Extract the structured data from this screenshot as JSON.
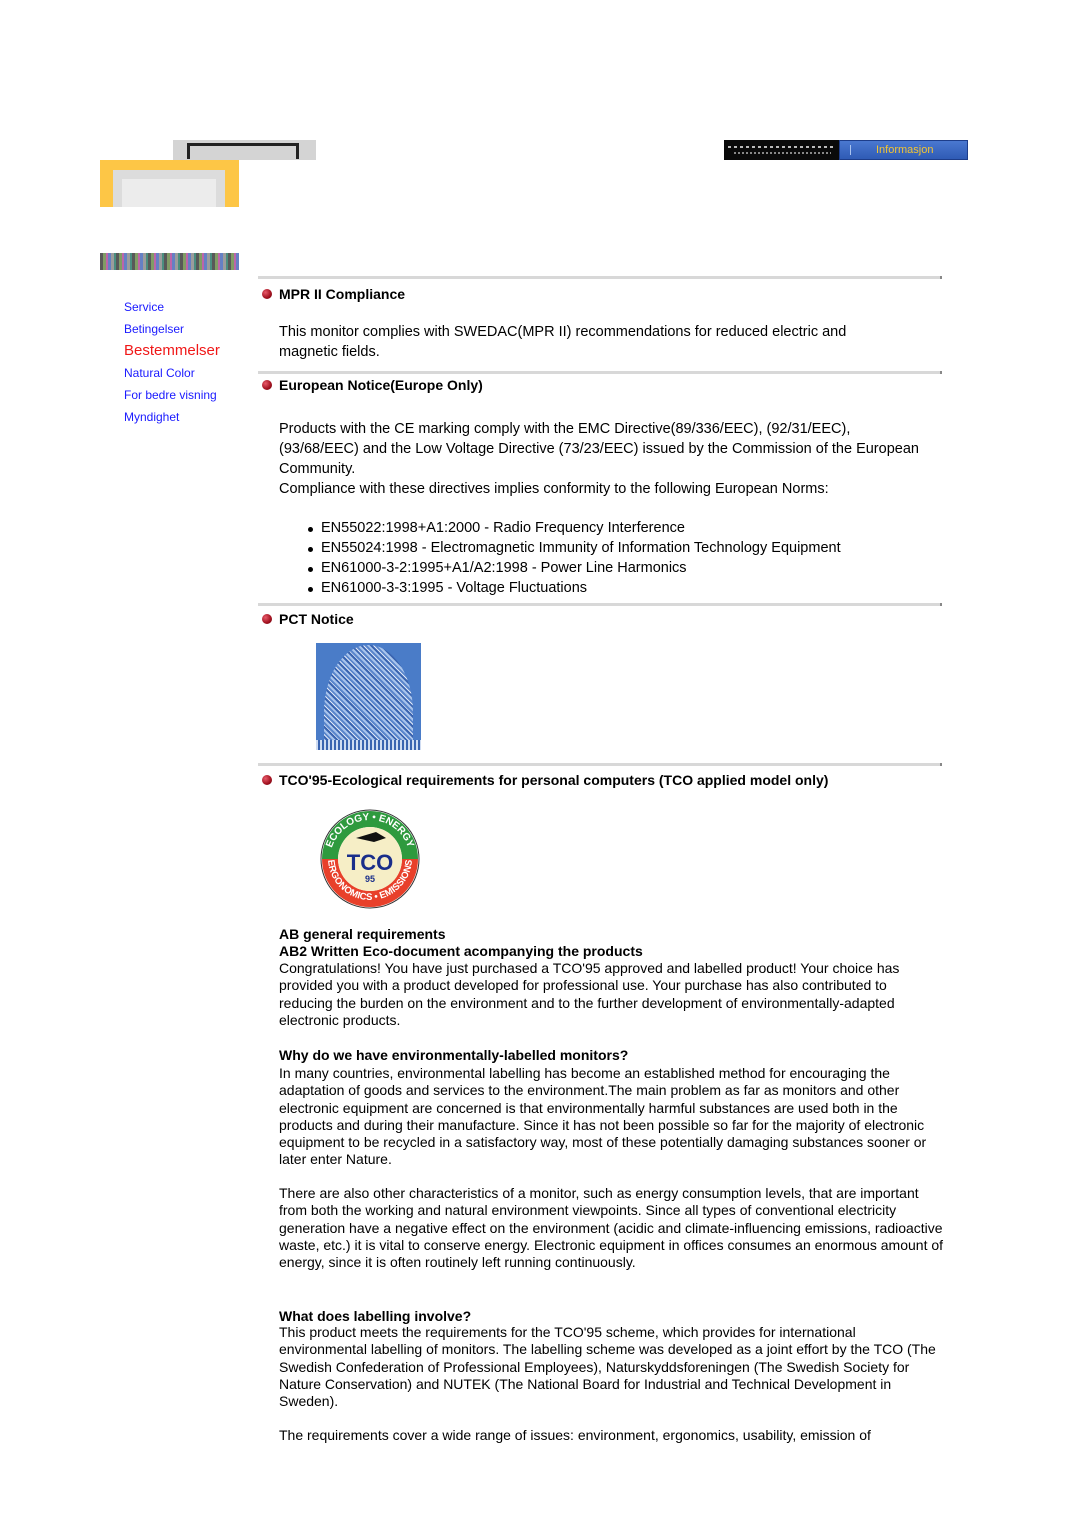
{
  "header": {
    "banner_label": "Informasjon"
  },
  "sidebar": {
    "items": [
      {
        "label": "Service",
        "active": false
      },
      {
        "label": "Betingelser",
        "active": false
      },
      {
        "label": "Bestemmelser",
        "active": true
      },
      {
        "label": "Natural Color",
        "active": false
      },
      {
        "label": "For bedre visning",
        "active": false
      },
      {
        "label": "Myndighet",
        "active": false
      }
    ]
  },
  "sections": {
    "mpr": {
      "title": "MPR II Compliance",
      "body": "This monitor complies with SWEDAC(MPR II) recommendations for reduced electric and magnetic fields."
    },
    "european": {
      "title": "European Notice(Europe Only)",
      "body1": "Products with the CE marking comply with the EMC Directive(89/336/EEC), (92/31/EEC), (93/68/EEC) and the Low Voltage Directive (73/23/EEC) issued by the Commission of the European Community.",
      "body2": "Compliance with these directives implies conformity to the following European Norms:",
      "norms": [
        "EN55022:1998+A1:2000 - Radio Frequency Interference",
        "EN55024:1998 - Electromagnetic Immunity of Information Technology Equipment",
        "EN61000-3-2:1995+A1/A2:1998 - Power Line Harmonics",
        "EN61000-3-3:1995 - Voltage Fluctuations"
      ]
    },
    "pct": {
      "title": "PCT Notice"
    },
    "tco": {
      "title": "TCO'95-Ecological requirements for personal computers (TCO applied model only)",
      "logo_texts": {
        "top": "ECOLOGY • ENERGY",
        "bottom": "ERGONOMICS • EMISSIONS",
        "center": "TCO",
        "year": "95"
      },
      "sub1": "AB general requirements",
      "sub2": "AB2 Written Eco-document acompanying the products",
      "congrats": "Congratulations! You have just purchased a TCO'95 approved and labelled product! Your choice has provided you with a product developed for professional use. Your purchase has also contributed to reducing the burden on the environment and to the further development of environmentally-adapted electronic products.",
      "why_title": "Why do we have environmentally-labelled monitors?",
      "why_body": "In many countries, environmental labelling has become an established method for encouraging the adaptation of goods and services to the environment.The main problem as far as monitors and other electronic equipment are concerned is that environmentally harmful substances are used both in the products and during their manufacture. Since it has not been possible so far for the majority of electronic equipment to be recycled in a satisfactory way, most of these potentially damaging substances sooner or later enter Nature.",
      "other_body": "There are also other characteristics of a monitor, such as energy consumption levels, that are important from both the working and natural environment viewpoints. Since all types of conventional electricity generation have a negative effect on the environment (acidic and climate-influencing emissions, radioactive waste, etc.) it is vital to conserve energy. Electronic equipment in offices consumes an enormous amount of energy, since it is often routinely left running continuously.",
      "labelling_title": "What does labelling involve?",
      "labelling_body": "This product meets the requirements for the TCO'95 scheme, which provides for international environmental labelling of monitors. The labelling scheme was developed as a joint effort by the TCO (The Swedish Confederation of Professional Employees), Naturskyddsforeningen (The Swedish Society for Nature Conservation) and NUTEK (The National Board for Industrial and Technical Development in Sweden).",
      "requirements_body": "The requirements cover a wide range of issues: environment, ergonomics, usability, emission of"
    }
  }
}
